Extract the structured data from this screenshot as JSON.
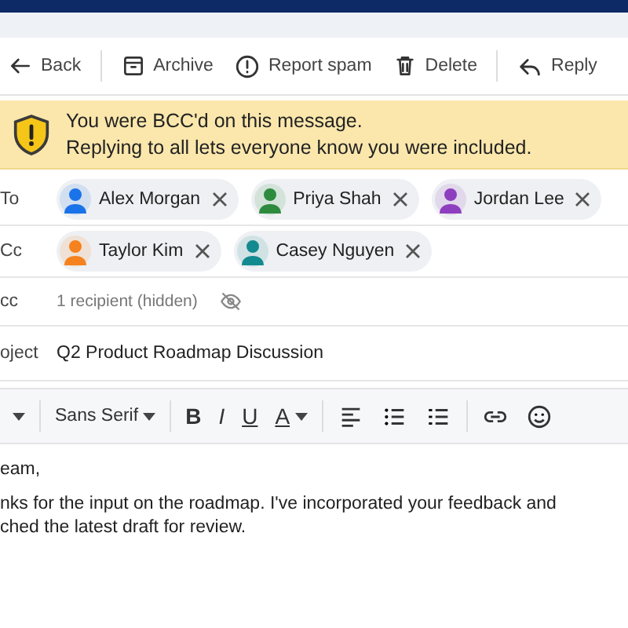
{
  "toolbar": {
    "actions": [
      {
        "kind": "back",
        "label": "Back"
      },
      {
        "kind": "divider"
      },
      {
        "kind": "archive",
        "label": "Archive"
      },
      {
        "kind": "spam",
        "label": "Report spam"
      },
      {
        "kind": "delete",
        "label": "Delete"
      },
      {
        "kind": "divider"
      },
      {
        "kind": "reply",
        "label": "Reply"
      }
    ]
  },
  "banner": {
    "title": "You were BCC'd on this message.",
    "text": "Replying to all lets everyone know you were included."
  },
  "fields": [
    {
      "kind": "chips",
      "label": "To",
      "chips": [
        {
          "name": "Alex Morgan",
          "color": "#1a73e8"
        },
        {
          "name": "Priya Shah",
          "color": "#2e8b3e"
        },
        {
          "name": "Jordan Lee",
          "color": "#8e3fbf"
        }
      ]
    },
    {
      "kind": "chips",
      "label": "Cc",
      "chips": [
        {
          "name": "Taylor Kim",
          "color": "#f5821f"
        },
        {
          "name": "Casey Nguyen",
          "color": "#138a8f"
        }
      ]
    },
    {
      "kind": "hidden",
      "label": "cc",
      "text": "1 recipient (hidden)"
    },
    {
      "kind": "subject",
      "label": "oject",
      "text": "Q2 Product Roadmap Discussion"
    }
  ],
  "format_bar": [
    {
      "kind": "caret"
    },
    {
      "kind": "font",
      "label": "Sans Serif"
    },
    {
      "kind": "bold",
      "label": "B"
    },
    {
      "kind": "italic",
      "label": "I"
    },
    {
      "kind": "underline",
      "label": "U"
    },
    {
      "kind": "color",
      "label": "A"
    },
    {
      "kind": "align"
    },
    {
      "kind": "bullets"
    },
    {
      "kind": "numbers"
    },
    {
      "kind": "link"
    },
    {
      "kind": "emoji"
    }
  ],
  "body": {
    "paragraphs": [
      [
        "eam,"
      ],
      [
        "nks for the input on the roadmap. I've incorporated your feedback and",
        "ched the latest draft for review."
      ]
    ]
  }
}
